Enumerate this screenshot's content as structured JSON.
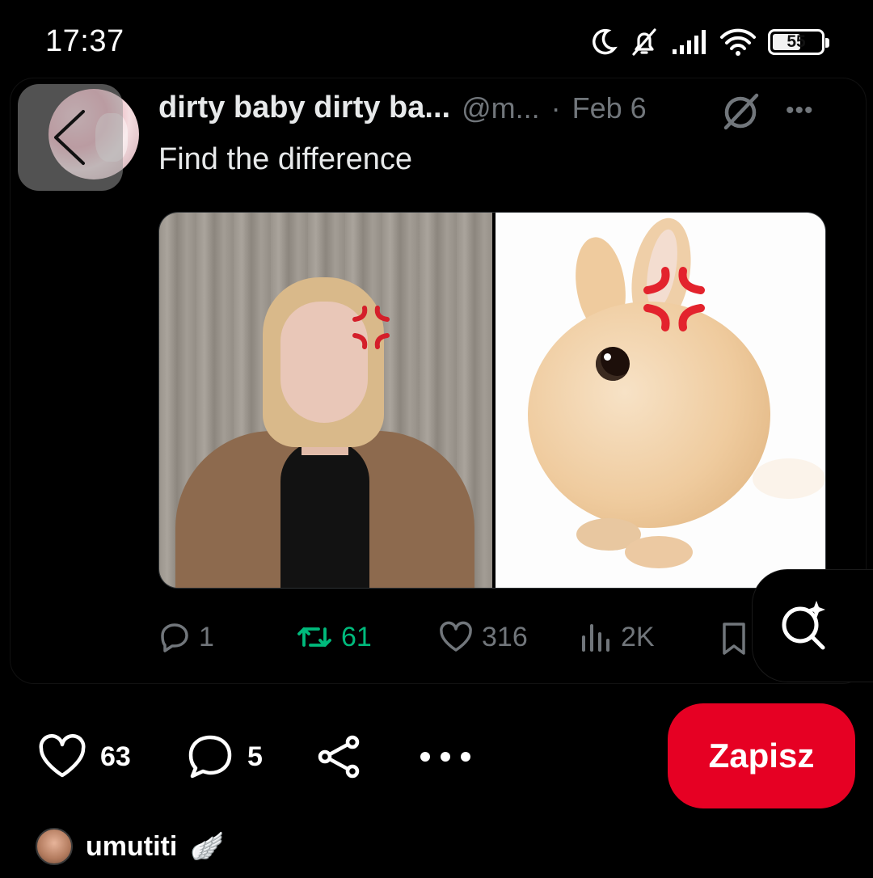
{
  "status_bar": {
    "time": "17:37",
    "battery_level": "55",
    "icons": [
      "moon-icon",
      "bell-off-icon",
      "signal-icon",
      "wifi-icon",
      "battery-icon"
    ]
  },
  "tweet": {
    "author_name": "dirty baby dirty ba...",
    "author_handle": "@m...",
    "separator": "·",
    "date": "Feb 6",
    "text": "Find the difference",
    "actions": {
      "replies": "1",
      "retweets": "61",
      "likes": "316",
      "views": "2K"
    }
  },
  "pin": {
    "likes": "63",
    "comments": "5",
    "save_label": "Zapisz",
    "creator_name": "umutiti",
    "creator_badge": "🪽"
  },
  "colors": {
    "save_button": "#e60023",
    "retweet_green": "#00ba7c",
    "muted_gray": "#71767b"
  }
}
